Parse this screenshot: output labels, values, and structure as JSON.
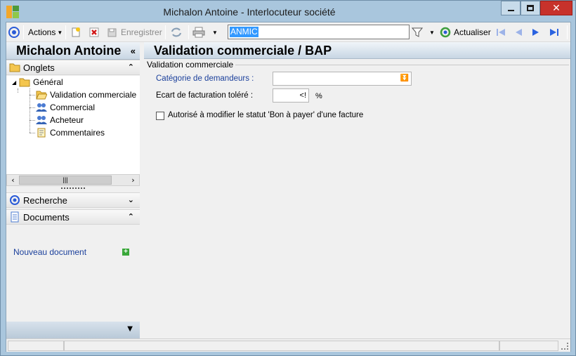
{
  "window": {
    "title": "Michalon Antoine -  Interlocuteur société"
  },
  "toolbar": {
    "actions_label": "Actions",
    "save_label": "Enregistrer",
    "search_value": "ANMIC",
    "refresh_label": "Actualiser"
  },
  "left": {
    "header_name": "Michalon Antoine",
    "tabs_section": "Onglets",
    "tree": {
      "root": "Général",
      "items": [
        "Validation commerciale",
        "Commercial",
        "Acheteur",
        "Commentaires"
      ]
    },
    "search_section": "Recherche",
    "documents_section": "Documents",
    "new_document": "Nouveau document"
  },
  "main": {
    "title": "Validation commerciale / BAP",
    "group_label": "Validation commerciale",
    "category_label": "Catégorie de demandeurs :",
    "tolerance_label": "Ecart de facturation toléré :",
    "tolerance_value": "<!",
    "percent": "%",
    "checkbox_label": "Autorisé à modifier le statut 'Bon à payer' d'une facture"
  },
  "colors": {
    "titlebar": "#a9c6dd",
    "close_button": "#c7322b",
    "link_blue": "#1a3f9b",
    "selection": "#3399ff"
  }
}
